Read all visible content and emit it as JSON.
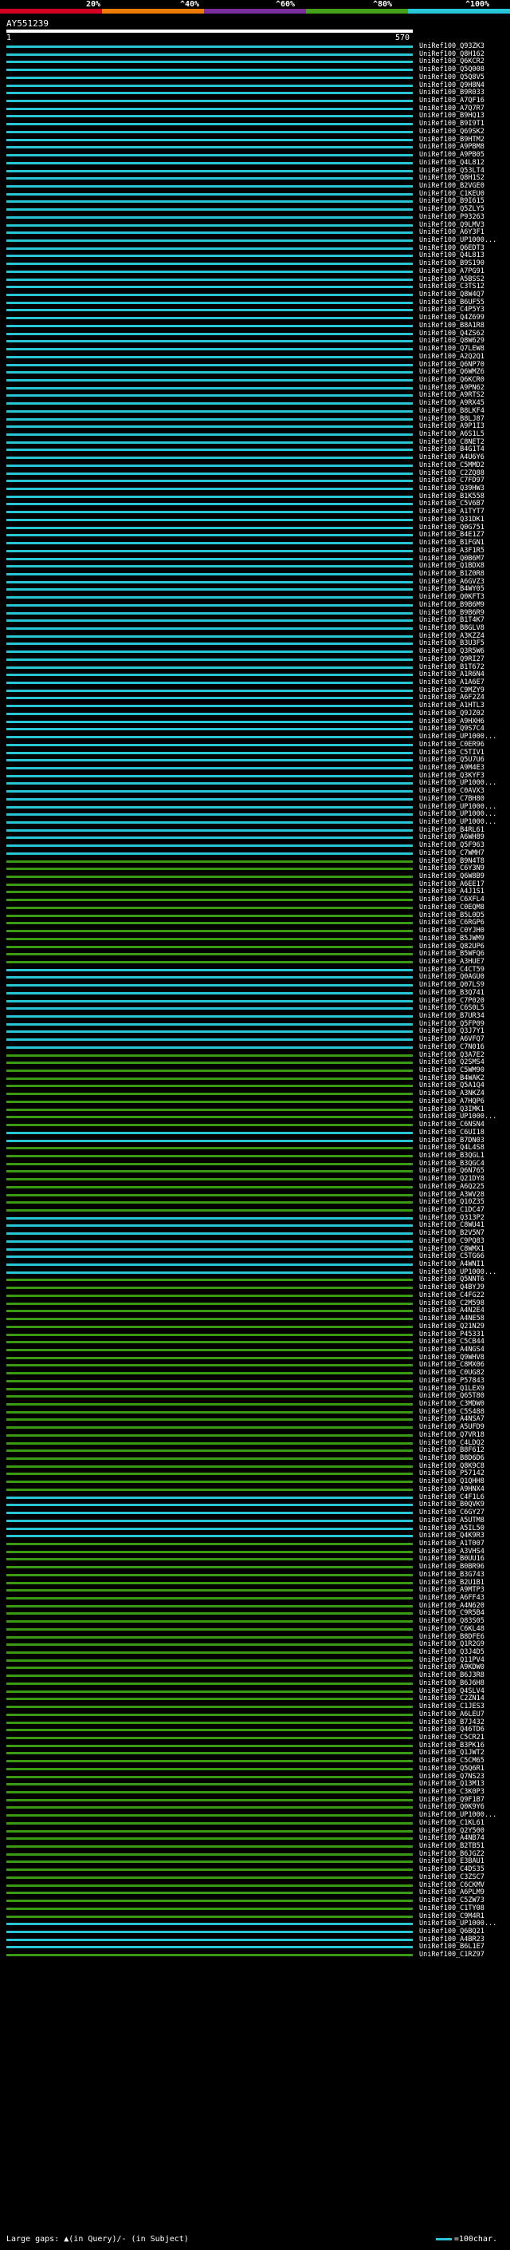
{
  "scale": {
    "ticks": [
      "20%",
      "^40%",
      "^60%",
      "^80%",
      "^100%"
    ],
    "colors": [
      "#d4001f",
      "#ef7b07",
      "#7c2ea0",
      "#46a11a",
      "#27c6d8"
    ]
  },
  "query": {
    "id": "AY551239",
    "start": "1",
    "end": "570"
  },
  "hits": [
    {
      "label": "UniRef100_Q93ZK3",
      "color": "cyan"
    },
    {
      "label": "UniRef100_Q8H162",
      "color": "cyan"
    },
    {
      "label": "UniRef100_Q6KCR2",
      "color": "cyan"
    },
    {
      "label": "UniRef100_Q5Q008",
      "color": "cyan"
    },
    {
      "label": "UniRef100_Q5Q8V5",
      "color": "cyan"
    },
    {
      "label": "UniRef100_Q9H8N4",
      "color": "cyan"
    },
    {
      "label": "UniRef100_B9R033",
      "color": "cyan"
    },
    {
      "label": "UniRef100_A7QF16",
      "color": "cyan"
    },
    {
      "label": "UniRef100_A7Q7R7",
      "color": "cyan"
    },
    {
      "label": "UniRef100_B9HQ13",
      "color": "cyan"
    },
    {
      "label": "UniRef100_B9I9T1",
      "color": "cyan"
    },
    {
      "label": "UniRef100_Q69SK2",
      "color": "cyan"
    },
    {
      "label": "UniRef100_B9HTM2",
      "color": "cyan"
    },
    {
      "label": "UniRef100_A9PBM8",
      "color": "cyan"
    },
    {
      "label": "UniRef100_A9PB05",
      "color": "cyan"
    },
    {
      "label": "UniRef100_Q4L812",
      "color": "cyan"
    },
    {
      "label": "UniRef100_Q53LT4",
      "color": "cyan"
    },
    {
      "label": "UniRef100_Q8H1S2",
      "color": "cyan"
    },
    {
      "label": "UniRef100_B2VGE0",
      "color": "cyan"
    },
    {
      "label": "UniRef100_C1KEU0",
      "color": "cyan"
    },
    {
      "label": "UniRef100_B9I615",
      "color": "cyan"
    },
    {
      "label": "UniRef100_Q5ZLY5",
      "color": "cyan"
    },
    {
      "label": "UniRef100_P93263",
      "color": "cyan"
    },
    {
      "label": "UniRef100_Q9LMV3",
      "color": "cyan"
    },
    {
      "label": "UniRef100_A6Y3F1",
      "color": "cyan"
    },
    {
      "label": "UniRef100_UP1000...",
      "color": "cyan"
    },
    {
      "label": "UniRef100_Q6EDT3",
      "color": "cyan"
    },
    {
      "label": "UniRef100_Q4L813",
      "color": "cyan"
    },
    {
      "label": "UniRef100_B9S190",
      "color": "cyan"
    },
    {
      "label": "UniRef100_A7PG91",
      "color": "cyan"
    },
    {
      "label": "UniRef100_A5BSS2",
      "color": "cyan"
    },
    {
      "label": "UniRef100_C3TS12",
      "color": "cyan"
    },
    {
      "label": "UniRef100_Q8W4Q7",
      "color": "cyan"
    },
    {
      "label": "UniRef100_B6UF55",
      "color": "cyan"
    },
    {
      "label": "UniRef100_C4P5Y3",
      "color": "cyan"
    },
    {
      "label": "UniRef100_Q4Z699",
      "color": "cyan"
    },
    {
      "label": "UniRef100_B8A1R8",
      "color": "cyan"
    },
    {
      "label": "UniRef100_Q4ZS62",
      "color": "cyan"
    },
    {
      "label": "UniRef100_Q8W629",
      "color": "cyan"
    },
    {
      "label": "UniRef100_Q7LEW8",
      "color": "cyan"
    },
    {
      "label": "UniRef100_A2Q2Q1",
      "color": "cyan"
    },
    {
      "label": "UniRef100_Q6NP70",
      "color": "cyan"
    },
    {
      "label": "UniRef100_Q6WMZ6",
      "color": "cyan"
    },
    {
      "label": "UniRef100_Q6KCR0",
      "color": "cyan"
    },
    {
      "label": "UniRef100_A9PN62",
      "color": "cyan"
    },
    {
      "label": "UniRef100_A9RTS2",
      "color": "cyan"
    },
    {
      "label": "UniRef100_A9RX45",
      "color": "cyan"
    },
    {
      "label": "UniRef100_B8LKF4",
      "color": "cyan"
    },
    {
      "label": "UniRef100_B8LJ87",
      "color": "cyan"
    },
    {
      "label": "UniRef100_A9P1I3",
      "color": "cyan"
    },
    {
      "label": "UniRef100_A6S1L5",
      "color": "cyan"
    },
    {
      "label": "UniRef100_C8NET2",
      "color": "cyan"
    },
    {
      "label": "UniRef100_B4G1T4",
      "color": "cyan"
    },
    {
      "label": "UniRef100_A4U6Y6",
      "color": "cyan"
    },
    {
      "label": "UniRef100_C5MMD2",
      "color": "cyan"
    },
    {
      "label": "UniRef100_C2ZQ88",
      "color": "cyan"
    },
    {
      "label": "UniRef100_C7FD97",
      "color": "cyan"
    },
    {
      "label": "UniRef100_Q39HW3",
      "color": "cyan"
    },
    {
      "label": "UniRef100_B1K558",
      "color": "cyan"
    },
    {
      "label": "UniRef100_C5V6B7",
      "color": "cyan"
    },
    {
      "label": "UniRef100_A1TYT7",
      "color": "cyan"
    },
    {
      "label": "UniRef100_Q31DK1",
      "color": "cyan"
    },
    {
      "label": "UniRef100_Q0G751",
      "color": "cyan"
    },
    {
      "label": "UniRef100_B4E1Z7",
      "color": "cyan"
    },
    {
      "label": "UniRef100_B1FGN1",
      "color": "cyan"
    },
    {
      "label": "UniRef100_A3F1R5",
      "color": "cyan"
    },
    {
      "label": "UniRef100_Q0B6M7",
      "color": "cyan"
    },
    {
      "label": "UniRef100_Q1BDX8",
      "color": "cyan"
    },
    {
      "label": "UniRef100_B1Z0R8",
      "color": "cyan"
    },
    {
      "label": "UniRef100_A6GVZ3",
      "color": "cyan"
    },
    {
      "label": "UniRef100_B4WY05",
      "color": "cyan"
    },
    {
      "label": "UniRef100_Q0KFT3",
      "color": "cyan"
    },
    {
      "label": "UniRef100_B9B6M9",
      "color": "cyan"
    },
    {
      "label": "UniRef100_B9B6R9",
      "color": "cyan"
    },
    {
      "label": "UniRef100_B1T4K7",
      "color": "cyan"
    },
    {
      "label": "UniRef100_B8GLV8",
      "color": "cyan"
    },
    {
      "label": "UniRef100_A3KZZ4",
      "color": "cyan"
    },
    {
      "label": "UniRef100_B3U3F5",
      "color": "cyan"
    },
    {
      "label": "UniRef100_Q3R5W6",
      "color": "cyan"
    },
    {
      "label": "UniRef100_Q9RI27",
      "color": "cyan"
    },
    {
      "label": "UniRef100_B1T672",
      "color": "cyan"
    },
    {
      "label": "UniRef100_A1R6N4",
      "color": "cyan"
    },
    {
      "label": "UniRef100_A1A6E7",
      "color": "cyan"
    },
    {
      "label": "UniRef100_C9MZY9",
      "color": "cyan"
    },
    {
      "label": "UniRef100_A6F2Z4",
      "color": "cyan"
    },
    {
      "label": "UniRef100_A1HTL3",
      "color": "cyan"
    },
    {
      "label": "UniRef100_Q9JZ02",
      "color": "cyan"
    },
    {
      "label": "UniRef100_A9HXH6",
      "color": "cyan"
    },
    {
      "label": "UniRef100_Q9S7C4",
      "color": "cyan"
    },
    {
      "label": "UniRef100_UP1000...",
      "color": "cyan"
    },
    {
      "label": "UniRef100_C0ER96",
      "color": "cyan"
    },
    {
      "label": "UniRef100_C5TIV1",
      "color": "cyan"
    },
    {
      "label": "UniRef100_Q5U7U6",
      "color": "cyan"
    },
    {
      "label": "UniRef100_A9M4E3",
      "color": "cyan"
    },
    {
      "label": "UniRef100_Q3KYF3",
      "color": "cyan"
    },
    {
      "label": "UniRef100_UP1000...",
      "color": "cyan"
    },
    {
      "label": "UniRef100_C0AVX3",
      "color": "cyan"
    },
    {
      "label": "UniRef100_C7BH80",
      "color": "cyan"
    },
    {
      "label": "UniRef100_UP1000...",
      "color": "cyan"
    },
    {
      "label": "UniRef100_UP1000...",
      "color": "cyan"
    },
    {
      "label": "UniRef100_UP1000...",
      "color": "cyan"
    },
    {
      "label": "UniRef100_B4RL61",
      "color": "cyan"
    },
    {
      "label": "UniRef100_A6WH89",
      "color": "cyan"
    },
    {
      "label": "UniRef100_Q5F963",
      "color": "cyan"
    },
    {
      "label": "UniRef100_C7WMH7",
      "color": "cyan"
    },
    {
      "label": "UniRef100_B9N4T8",
      "color": "green"
    },
    {
      "label": "UniRef100_C6Y3N9",
      "color": "green"
    },
    {
      "label": "UniRef100_Q6W8B9",
      "color": "green"
    },
    {
      "label": "UniRef100_A6EE17",
      "color": "green"
    },
    {
      "label": "UniRef100_A4J1S1",
      "color": "green"
    },
    {
      "label": "UniRef100_C6XFL4",
      "color": "green"
    },
    {
      "label": "UniRef100_C0EQM8",
      "color": "green"
    },
    {
      "label": "UniRef100_B5L0D5",
      "color": "green"
    },
    {
      "label": "UniRef100_C6RGP6",
      "color": "green"
    },
    {
      "label": "UniRef100_C0YJH0",
      "color": "green"
    },
    {
      "label": "UniRef100_B5JWM9",
      "color": "green"
    },
    {
      "label": "UniRef100_Q82UP6",
      "color": "green"
    },
    {
      "label": "UniRef100_B5WFQ6",
      "color": "green"
    },
    {
      "label": "UniRef100_A3HUE7",
      "color": "green"
    },
    {
      "label": "UniRef100_C4CT59",
      "color": "cyan"
    },
    {
      "label": "UniRef100_Q0AGU0",
      "color": "cyan"
    },
    {
      "label": "UniRef100_Q07LS9",
      "color": "cyan"
    },
    {
      "label": "UniRef100_B3Q741",
      "color": "cyan"
    },
    {
      "label": "UniRef100_C7P020",
      "color": "cyan"
    },
    {
      "label": "UniRef100_C6S0L5",
      "color": "cyan"
    },
    {
      "label": "UniRef100_B7UR34",
      "color": "cyan"
    },
    {
      "label": "UniRef100_Q5FP09",
      "color": "cyan"
    },
    {
      "label": "UniRef100_Q3J7Y1",
      "color": "cyan"
    },
    {
      "label": "UniRef100_A6VFQ7",
      "color": "cyan"
    },
    {
      "label": "UniRef100_C7N016",
      "color": "cyan"
    },
    {
      "label": "UniRef100_Q3A7E2",
      "color": "green"
    },
    {
      "label": "UniRef100_Q2SMS4",
      "color": "green"
    },
    {
      "label": "UniRef100_C5WM90",
      "color": "green"
    },
    {
      "label": "UniRef100_B4WAK2",
      "color": "green"
    },
    {
      "label": "UniRef100_Q5A1Q4",
      "color": "green"
    },
    {
      "label": "UniRef100_A3NKZ4",
      "color": "green"
    },
    {
      "label": "UniRef100_A7HQP6",
      "color": "green"
    },
    {
      "label": "UniRef100_Q3IMK1",
      "color": "green"
    },
    {
      "label": "UniRef100_UP1000...",
      "color": "green"
    },
    {
      "label": "UniRef100_C6NSN4",
      "color": "green"
    },
    {
      "label": "UniRef100_C6UI18",
      "color": "cyan"
    },
    {
      "label": "UniRef100_B7DN03",
      "color": "cyan"
    },
    {
      "label": "UniRef100_Q4L4S8",
      "color": "green"
    },
    {
      "label": "UniRef100_B3QGL1",
      "color": "green"
    },
    {
      "label": "UniRef100_B3QGC4",
      "color": "green"
    },
    {
      "label": "UniRef100_Q6N765",
      "color": "green"
    },
    {
      "label": "UniRef100_Q21DY8",
      "color": "green"
    },
    {
      "label": "UniRef100_A6Q225",
      "color": "green"
    },
    {
      "label": "UniRef100_A3WV28",
      "color": "green"
    },
    {
      "label": "UniRef100_Q10Z35",
      "color": "green"
    },
    {
      "label": "UniRef100_C1DC47",
      "color": "green"
    },
    {
      "label": "UniRef100_Q313P2",
      "color": "cyan"
    },
    {
      "label": "UniRef100_C8WU41",
      "color": "cyan"
    },
    {
      "label": "UniRef100_B2V5N7",
      "color": "cyan"
    },
    {
      "label": "UniRef100_C9PQ83",
      "color": "cyan"
    },
    {
      "label": "UniRef100_C8WMX1",
      "color": "cyan"
    },
    {
      "label": "UniRef100_C5TG66",
      "color": "cyan"
    },
    {
      "label": "UniRef100_A4WNI1",
      "color": "cyan"
    },
    {
      "label": "UniRef100_UP1000...",
      "color": "cyan"
    },
    {
      "label": "UniRef100_Q5NNT6",
      "color": "green"
    },
    {
      "label": "UniRef100_Q4BYJ9",
      "color": "green"
    },
    {
      "label": "UniRef100_C4FG22",
      "color": "green"
    },
    {
      "label": "UniRef100_C2M598",
      "color": "green"
    },
    {
      "label": "UniRef100_A4N2E4",
      "color": "green"
    },
    {
      "label": "UniRef100_A4NE58",
      "color": "green"
    },
    {
      "label": "UniRef100_Q21N29",
      "color": "green"
    },
    {
      "label": "UniRef100_P45331",
      "color": "green"
    },
    {
      "label": "UniRef100_C5CB44",
      "color": "green"
    },
    {
      "label": "UniRef100_A4NGS4",
      "color": "green"
    },
    {
      "label": "UniRef100_Q9WHV8",
      "color": "green"
    },
    {
      "label": "UniRef100_C8MX06",
      "color": "green"
    },
    {
      "label": "UniRef100_C0UG82",
      "color": "green"
    },
    {
      "label": "UniRef100_P57843",
      "color": "green"
    },
    {
      "label": "UniRef100_Q1LEX9",
      "color": "green"
    },
    {
      "label": "UniRef100_Q65T80",
      "color": "green"
    },
    {
      "label": "UniRef100_C3MDW0",
      "color": "green"
    },
    {
      "label": "UniRef100_C5S488",
      "color": "green"
    },
    {
      "label": "UniRef100_A4NSA7",
      "color": "green"
    },
    {
      "label": "UniRef100_A5UFD9",
      "color": "green"
    },
    {
      "label": "UniRef100_Q7VR18",
      "color": "green"
    },
    {
      "label": "UniRef100_C4LDQ2",
      "color": "green"
    },
    {
      "label": "UniRef100_B8F612",
      "color": "green"
    },
    {
      "label": "UniRef100_B8D6D6",
      "color": "green"
    },
    {
      "label": "UniRef100_Q8K9C8",
      "color": "green"
    },
    {
      "label": "UniRef100_P57142",
      "color": "green"
    },
    {
      "label": "UniRef100_Q1QHH8",
      "color": "green"
    },
    {
      "label": "UniRef100_A9HNX4",
      "color": "green"
    },
    {
      "label": "UniRef100_C4F1L6",
      "color": "cyan"
    },
    {
      "label": "UniRef100_B0QVK9",
      "color": "cyan"
    },
    {
      "label": "UniRef100_C6GY27",
      "color": "cyan"
    },
    {
      "label": "UniRef100_A5UTM8",
      "color": "cyan"
    },
    {
      "label": "UniRef100_A5IL50",
      "color": "cyan"
    },
    {
      "label": "UniRef100_Q4K9R3",
      "color": "cyan"
    },
    {
      "label": "UniRef100_A1T007",
      "color": "green"
    },
    {
      "label": "UniRef100_A3VHS4",
      "color": "green"
    },
    {
      "label": "UniRef100_B0UU16",
      "color": "green"
    },
    {
      "label": "UniRef100_B0BR96",
      "color": "green"
    },
    {
      "label": "UniRef100_B3G743",
      "color": "green"
    },
    {
      "label": "UniRef100_B2U1B1",
      "color": "green"
    },
    {
      "label": "UniRef100_A9MTP3",
      "color": "green"
    },
    {
      "label": "UniRef100_A6FF43",
      "color": "green"
    },
    {
      "label": "UniRef100_A4N620",
      "color": "green"
    },
    {
      "label": "UniRef100_C9R5B4",
      "color": "green"
    },
    {
      "label": "UniRef100_Q83S05",
      "color": "green"
    },
    {
      "label": "UniRef100_C6KL48",
      "color": "green"
    },
    {
      "label": "UniRef100_B8DFE6",
      "color": "green"
    },
    {
      "label": "UniRef100_Q1R2G9",
      "color": "green"
    },
    {
      "label": "UniRef100_Q3J4D5",
      "color": "green"
    },
    {
      "label": "UniRef100_Q11PV4",
      "color": "green"
    },
    {
      "label": "UniRef100_A9KDW0",
      "color": "green"
    },
    {
      "label": "UniRef100_B6J3R8",
      "color": "green"
    },
    {
      "label": "UniRef100_B6J6H8",
      "color": "green"
    },
    {
      "label": "UniRef100_Q4SLV4",
      "color": "green"
    },
    {
      "label": "UniRef100_C2ZN14",
      "color": "green"
    },
    {
      "label": "UniRef100_C1JES3",
      "color": "green"
    },
    {
      "label": "UniRef100_A6LEU7",
      "color": "green"
    },
    {
      "label": "UniRef100_B7J432",
      "color": "green"
    },
    {
      "label": "UniRef100_Q46TD6",
      "color": "green"
    },
    {
      "label": "UniRef100_C5CR21",
      "color": "green"
    },
    {
      "label": "UniRef100_B3PK16",
      "color": "green"
    },
    {
      "label": "UniRef100_Q1JWT2",
      "color": "green"
    },
    {
      "label": "UniRef100_C5CM65",
      "color": "green"
    },
    {
      "label": "UniRef100_Q5Q6R1",
      "color": "green"
    },
    {
      "label": "UniRef100_Q7NS23",
      "color": "green"
    },
    {
      "label": "UniRef100_Q13M13",
      "color": "green"
    },
    {
      "label": "UniRef100_C3K0P3",
      "color": "green"
    },
    {
      "label": "UniRef100_Q9F1B7",
      "color": "green"
    },
    {
      "label": "UniRef100_Q0K9Y6",
      "color": "green"
    },
    {
      "label": "UniRef100_UP1000...",
      "color": "green"
    },
    {
      "label": "UniRef100_C1KL61",
      "color": "green"
    },
    {
      "label": "UniRef100_Q2Y500",
      "color": "green"
    },
    {
      "label": "UniRef100_A4NB74",
      "color": "green"
    },
    {
      "label": "UniRef100_B2TB51",
      "color": "green"
    },
    {
      "label": "UniRef100_B6JGZ2",
      "color": "green"
    },
    {
      "label": "UniRef100_E3BAU1",
      "color": "green"
    },
    {
      "label": "UniRef100_C4DS35",
      "color": "green"
    },
    {
      "label": "UniRef100_C3ZSC7",
      "color": "green"
    },
    {
      "label": "UniRef100_C6CKMV",
      "color": "green"
    },
    {
      "label": "UniRef100_A6PLM9",
      "color": "green"
    },
    {
      "label": "UniRef100_C5ZW73",
      "color": "green"
    },
    {
      "label": "UniRef100_C1TY08",
      "color": "green"
    },
    {
      "label": "UniRef100_C9M4R1",
      "color": "green"
    },
    {
      "label": "UniRef100_UP1000...",
      "color": "cyan"
    },
    {
      "label": "UniRef100_Q6BQ21",
      "color": "cyan"
    },
    {
      "label": "UniRef100_A4BR23",
      "color": "cyan"
    },
    {
      "label": "UniRef100_B6L1E7",
      "color": "cyan"
    },
    {
      "label": "UniRef100_C1RZ97",
      "color": "green"
    }
  ],
  "footer": {
    "large_gaps_label": "Large gaps:",
    "gap_legend": "▲(in Query)/- (in Subject)",
    "scale_label": "=100char."
  }
}
